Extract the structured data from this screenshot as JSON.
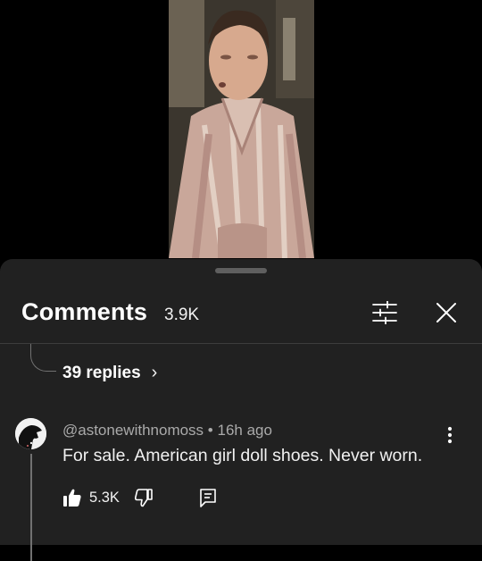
{
  "video": {
    "description_icon": "video-frame"
  },
  "comments_header": {
    "title": "Comments",
    "count": "3.9K",
    "filter_icon": "sliders-icon",
    "close_icon": "close-icon"
  },
  "thread": {
    "replies_label": "39 replies",
    "replies_chevron": "›"
  },
  "comment": {
    "author": "@astonewithnomoss",
    "separator": "•",
    "time": "16h ago",
    "text": "For sale. American girl doll shoes. Never worn.",
    "likes": "5.3K",
    "more_icon": "more-vert-icon",
    "like_icon": "thumbs-up-filled-icon",
    "dislike_icon": "thumbs-down-icon",
    "reply_icon": "reply-icon"
  },
  "colors": {
    "sheet_bg": "#212121",
    "page_bg": "#000000",
    "muted_text": "#aaaaaa"
  }
}
